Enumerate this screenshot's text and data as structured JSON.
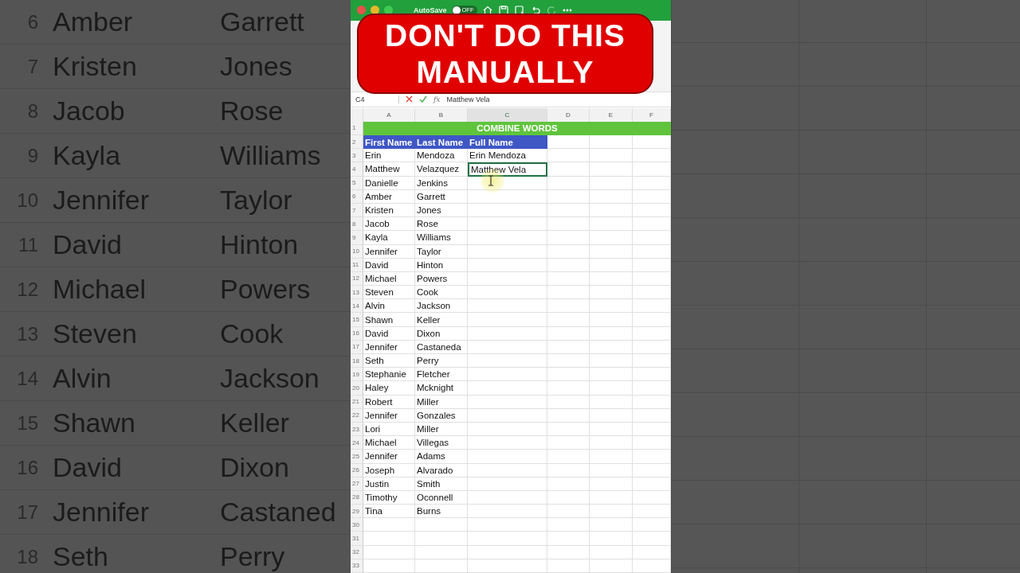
{
  "background_rows": [
    {
      "num": "6",
      "first": "Amber",
      "last": "Garrett"
    },
    {
      "num": "7",
      "first": "Kristen",
      "last": "Jones"
    },
    {
      "num": "8",
      "first": "Jacob",
      "last": "Rose"
    },
    {
      "num": "9",
      "first": "Kayla",
      "last": "Williams"
    },
    {
      "num": "10",
      "first": "Jennifer",
      "last": "Taylor"
    },
    {
      "num": "11",
      "first": "David",
      "last": "Hinton"
    },
    {
      "num": "12",
      "first": "Michael",
      "last": "Powers"
    },
    {
      "num": "13",
      "first": "Steven",
      "last": "Cook"
    },
    {
      "num": "14",
      "first": "Alvin",
      "last": "Jackson"
    },
    {
      "num": "15",
      "first": "Shawn",
      "last": "Keller"
    },
    {
      "num": "16",
      "first": "David",
      "last": "Dixon"
    },
    {
      "num": "17",
      "first": "Jennifer",
      "last": "Castaned"
    },
    {
      "num": "18",
      "first": "Seth",
      "last": "Perry"
    }
  ],
  "title_bar": {
    "autosave_label": "AutoSave",
    "autosave_on": false,
    "toggle_text": "OFF"
  },
  "banner": {
    "lines": [
      "DON'T DO THIS",
      "MANUALLY"
    ]
  },
  "formula_bar": {
    "name_box": "C4",
    "function_label": "fx",
    "value": "Matthew Vela"
  },
  "sheet": {
    "columns": [
      {
        "label": "A",
        "selected": false
      },
      {
        "label": "B",
        "selected": false
      },
      {
        "label": "C",
        "selected": true
      },
      {
        "label": "D",
        "selected": false
      },
      {
        "label": "E",
        "selected": false
      },
      {
        "label": "F",
        "selected": false
      }
    ],
    "title_row": {
      "num": "1",
      "text": "COMBINE WORDS"
    },
    "header_row": {
      "num": "2",
      "cells": [
        "First Name",
        "Last Name",
        "Full Name"
      ]
    },
    "rows": [
      {
        "num": "3",
        "first": "Erin",
        "last": "Mendoza",
        "full": "Erin Mendoza",
        "selected": false
      },
      {
        "num": "4",
        "first": "Matthew",
        "last": "Velazquez",
        "full": "Matthew Vela",
        "selected": true
      },
      {
        "num": "5",
        "first": "Danielle",
        "last": "Jenkins",
        "selected": false
      },
      {
        "num": "6",
        "first": "Amber",
        "last": "Garrett",
        "selected": false
      },
      {
        "num": "7",
        "first": "Kristen",
        "last": "Jones",
        "selected": false
      },
      {
        "num": "8",
        "first": "Jacob",
        "last": "Rose",
        "selected": false
      },
      {
        "num": "9",
        "first": "Kayla",
        "last": "Williams",
        "selected": false
      },
      {
        "num": "10",
        "first": "Jennifer",
        "last": "Taylor",
        "selected": false
      },
      {
        "num": "11",
        "first": "David",
        "last": "Hinton",
        "selected": false
      },
      {
        "num": "12",
        "first": "Michael",
        "last": "Powers",
        "selected": false
      },
      {
        "num": "13",
        "first": "Steven",
        "last": "Cook",
        "selected": false
      },
      {
        "num": "14",
        "first": "Alvin",
        "last": "Jackson",
        "selected": false
      },
      {
        "num": "15",
        "first": "Shawn",
        "last": "Keller",
        "selected": false
      },
      {
        "num": "16",
        "first": "David",
        "last": "Dixon",
        "selected": false
      },
      {
        "num": "17",
        "first": "Jennifer",
        "last": "Castaneda",
        "selected": false
      },
      {
        "num": "18",
        "first": "Seth",
        "last": "Perry",
        "selected": false
      },
      {
        "num": "19",
        "first": "Stephanie",
        "last": "Fletcher",
        "selected": false
      },
      {
        "num": "20",
        "first": "Haley",
        "last": "Mcknight",
        "selected": false
      },
      {
        "num": "21",
        "first": "Robert",
        "last": "Miller",
        "selected": false
      },
      {
        "num": "22",
        "first": "Jennifer",
        "last": "Gonzales",
        "selected": false
      },
      {
        "num": "23",
        "first": "Lori",
        "last": "Miller",
        "selected": false
      },
      {
        "num": "24",
        "first": "Michael",
        "last": "Villegas",
        "selected": false
      },
      {
        "num": "25",
        "first": "Jennifer",
        "last": "Adams",
        "selected": false
      },
      {
        "num": "26",
        "first": "Joseph",
        "last": "Alvarado",
        "selected": false
      },
      {
        "num": "27",
        "first": "Justin",
        "last": "Smith",
        "selected": false
      },
      {
        "num": "28",
        "first": "Timothy",
        "last": "Oconnell",
        "selected": false
      },
      {
        "num": "29",
        "first": "Tina",
        "last": "Burns",
        "selected": false
      }
    ],
    "empty_rows": [
      "30",
      "31",
      "32",
      "33"
    ]
  }
}
